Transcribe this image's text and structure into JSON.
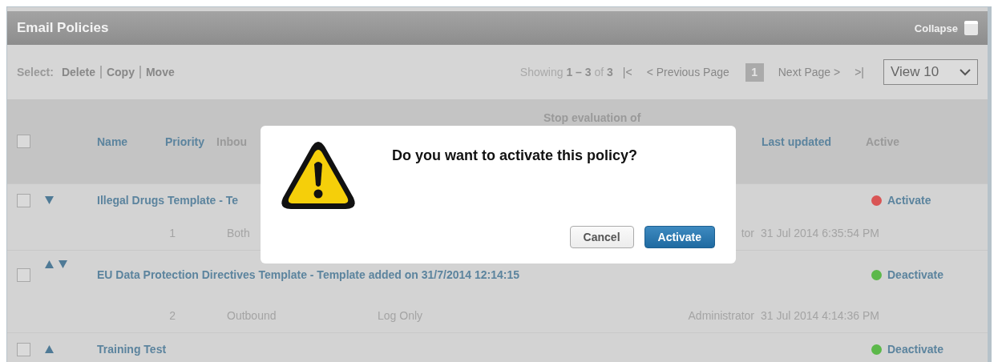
{
  "panel": {
    "title": "Email Policies",
    "collapse_label": "Collapse"
  },
  "toolbar": {
    "select_label": "Select:",
    "actions": [
      "Delete",
      "Copy",
      "Move"
    ],
    "showing": "Showing **1 – 3** of **3**",
    "first": "|<",
    "previous": "< Previous Page",
    "page": "1",
    "next": "Next Page >",
    "last": ">|",
    "view": "View 10"
  },
  "table": {
    "select_all": {
      "checked": false
    },
    "columns": [
      {
        "label": "Name",
        "kind": "link"
      },
      {
        "label": "Priority",
        "kind": "link"
      },
      {
        "label": "Inbou",
        "kind": "plain"
      },
      {
        "label": "Stop evaluation of",
        "kind": "plain"
      },
      {
        "label": "Last updated",
        "kind": "link"
      },
      {
        "label": "Active",
        "kind": "plain"
      }
    ],
    "rows": [
      {
        "checked": false,
        "name": "Illegal Drugs Template - Te",
        "move_up": false,
        "move_down": true,
        "priority": "1",
        "direction": "Both",
        "updated_by": "tor",
        "updated": "31 Jul 2014 6:35:54 PM",
        "status": {
          "label": "Activate",
          "color": "#d95555"
        }
      },
      {
        "checked": false,
        "name": "EU Data Protection Directives Template - Template added on 31/7/2014 12:14:15",
        "move_up": true,
        "move_down": true,
        "priority": "2",
        "direction": "Outbound",
        "action": "Log Only",
        "updated_by": "Administrator",
        "updated": "31 Jul 2014 4:14:36 PM",
        "status": {
          "label": "Deactivate",
          "color": "#5cb84a"
        }
      },
      {
        "checked": false,
        "name": "Training Test",
        "move_up": true,
        "move_down": false,
        "status": {
          "label": "Deactivate",
          "color": "#5cb84a"
        }
      }
    ]
  },
  "dialog": {
    "message": "Do you want to activate this policy?",
    "buttons": [
      {
        "label": "Cancel",
        "kind": "secondary"
      },
      {
        "label": "Activate",
        "kind": "primary"
      }
    ]
  }
}
